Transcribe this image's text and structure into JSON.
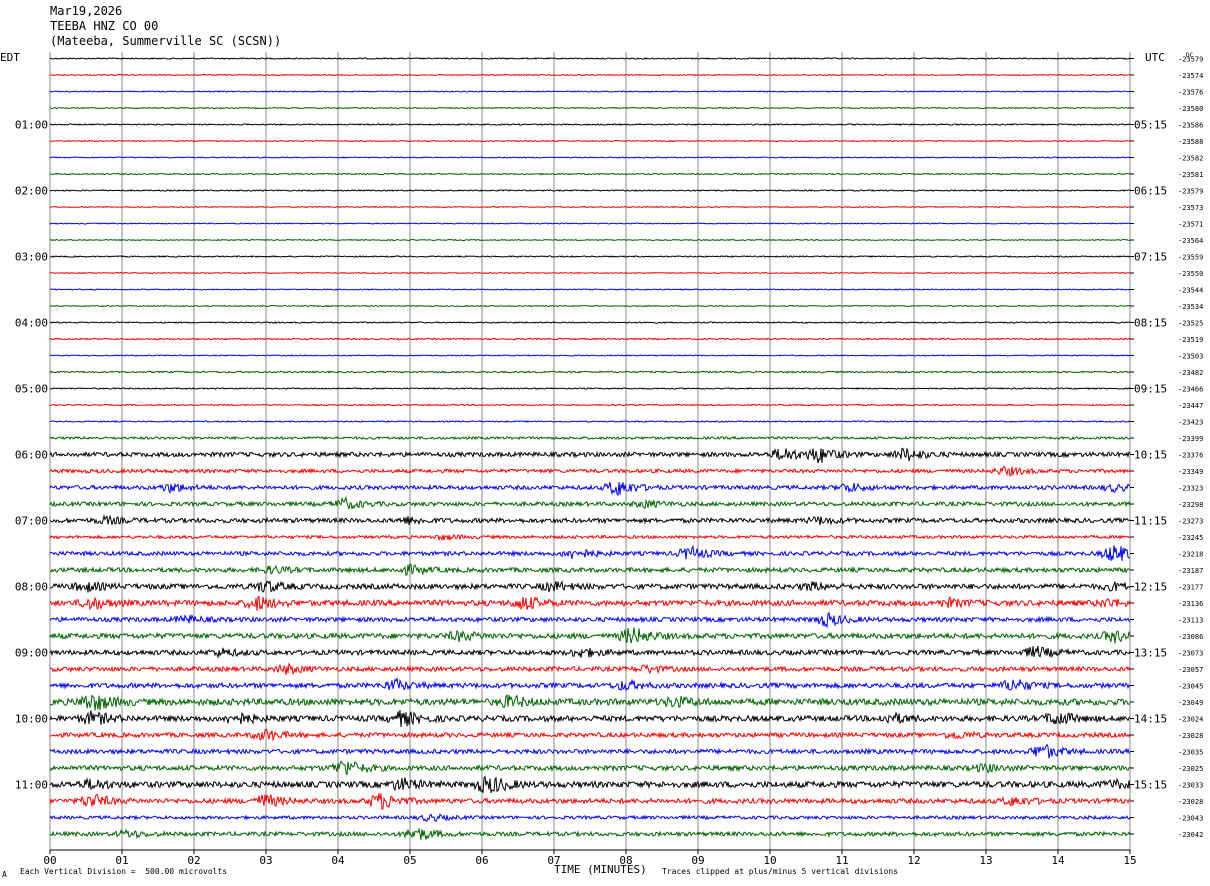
{
  "header": {
    "date": "Mar19,2026",
    "channel": "TEEBA HNZ CO 00",
    "location": "(Mateeba, Summerville SC (SCSN))"
  },
  "footer": {
    "scale_note": "Each Vertical Division =  500.00 microvolts",
    "clip_note": "Traces clipped at plus/minus 5 vertical divisions",
    "corner_mark": "A"
  },
  "chart_data": {
    "type": "line",
    "title": "TEEBA HNZ CO 00",
    "xlabel": "TIME (MINUTES)",
    "left_axis_label": "EDT",
    "right_axis_label": "UTC",
    "right_top_label": "DC",
    "x_ticks": [
      "00",
      "01",
      "02",
      "03",
      "04",
      "05",
      "06",
      "07",
      "08",
      "09",
      "10",
      "11",
      "12",
      "13",
      "14",
      "15"
    ],
    "xlim": [
      0,
      15
    ],
    "grid": true,
    "trace_colors": [
      "#000000",
      "#ff0000",
      "#0000ff",
      "#006400"
    ],
    "left_hour_labels": [
      "01:00",
      "02:00",
      "03:00",
      "04:00",
      "05:00",
      "06:00",
      "07:00",
      "08:00",
      "09:00",
      "10:00",
      "11:00"
    ],
    "right_hour_labels": [
      "05:15",
      "06:15",
      "07:15",
      "08:15",
      "09:15",
      "10:15",
      "11:15",
      "12:15",
      "13:15",
      "14:15",
      "15:15"
    ],
    "dc_offsets": [
      "-23579",
      "-23574",
      "-23576",
      "-23580",
      "-23586",
      "-23588",
      "-23582",
      "-23581",
      "-23579",
      "-23573",
      "-23571",
      "-23564",
      "-23559",
      "-23550",
      "-23544",
      "-23534",
      "-23525",
      "-23519",
      "-23503",
      "-23482",
      "-23466",
      "-23447",
      "-23423",
      "-23399",
      "-23376",
      "-23349",
      "-23323",
      "-23298",
      "-23273",
      "-23245",
      "-23218",
      "-23187",
      "-23177",
      "-23136",
      "-23113",
      "-23086",
      "-23073",
      "-23057",
      "-23045",
      "-23049",
      "-23024",
      "-23028",
      "-23035",
      "-23025",
      "-23033",
      "-23028",
      "-23043",
      "-23042"
    ],
    "noise_levels": [
      0.6,
      0.5,
      0.5,
      0.5,
      0.6,
      0.5,
      0.5,
      0.6,
      0.6,
      0.5,
      0.5,
      0.5,
      0.6,
      0.5,
      0.5,
      0.5,
      0.6,
      0.7,
      0.5,
      0.8,
      0.6,
      0.6,
      0.6,
      1.2,
      2.2,
      1.8,
      2.0,
      2.0,
      2.2,
      1.5,
      2.0,
      2.2,
      2.6,
      2.8,
      2.2,
      2.6,
      2.4,
      2.2,
      2.4,
      3.2,
      2.8,
      2.2,
      2.2,
      2.4,
      3.0,
      2.4,
      1.6,
      2.0
    ],
    "events": [
      [],
      [],
      [],
      [],
      [],
      [],
      [],
      [],
      [],
      [],
      [],
      [],
      [],
      [],
      [],
      [],
      [],
      [],
      [],
      [],
      [],
      [],
      [],
      [],
      [
        [
          10.2,
          6
        ],
        [
          10.7,
          7
        ],
        [
          11.9,
          6
        ]
      ],
      [
        [
          13.3,
          4
        ]
      ],
      [
        [
          1.7,
          4
        ],
        [
          7.9,
          8
        ],
        [
          11.1,
          4
        ],
        [
          14.8,
          3
        ]
      ],
      [
        [
          4.1,
          5
        ],
        [
          8.3,
          3
        ]
      ],
      [
        [
          0.8,
          3
        ],
        [
          5.0,
          3
        ],
        [
          10.7,
          3
        ]
      ],
      [
        [
          5.5,
          2
        ]
      ],
      [
        [
          7.3,
          5
        ],
        [
          8.9,
          6
        ],
        [
          14.8,
          9
        ]
      ],
      [
        [
          3.1,
          3
        ],
        [
          5.0,
          4
        ]
      ],
      [
        [
          0.5,
          4
        ],
        [
          3.0,
          5
        ],
        [
          7.0,
          4
        ],
        [
          10.6,
          3
        ],
        [
          14.8,
          3
        ]
      ],
      [
        [
          0.6,
          5
        ],
        [
          2.9,
          6
        ],
        [
          6.6,
          6
        ],
        [
          12.5,
          3
        ],
        [
          14.7,
          3
        ]
      ],
      [
        [
          1.9,
          3
        ],
        [
          10.8,
          6
        ]
      ],
      [
        [
          5.7,
          4
        ],
        [
          8.1,
          8
        ],
        [
          14.8,
          5
        ]
      ],
      [
        [
          2.4,
          3
        ],
        [
          7.4,
          4
        ],
        [
          13.7,
          5
        ]
      ],
      [
        [
          3.3,
          4
        ],
        [
          8.3,
          3
        ]
      ],
      [
        [
          4.8,
          5
        ],
        [
          8.0,
          4
        ],
        [
          13.4,
          6
        ]
      ],
      [
        [
          0.6,
          9
        ],
        [
          6.4,
          5
        ],
        [
          8.7,
          4
        ]
      ],
      [
        [
          0.6,
          6
        ],
        [
          2.6,
          5
        ],
        [
          4.9,
          7
        ],
        [
          11.7,
          4
        ],
        [
          14.0,
          6
        ]
      ],
      [
        [
          3.0,
          5
        ],
        [
          12.6,
          3
        ]
      ],
      [
        [
          13.8,
          7
        ]
      ],
      [
        [
          4.1,
          8
        ],
        [
          13.0,
          3
        ]
      ],
      [
        [
          0.6,
          4
        ],
        [
          4.9,
          5
        ],
        [
          6.1,
          9
        ],
        [
          14.8,
          3
        ]
      ],
      [
        [
          0.6,
          6
        ],
        [
          3.0,
          6
        ],
        [
          4.6,
          8
        ],
        [
          13.4,
          4
        ]
      ],
      [
        [
          5.3,
          3
        ]
      ],
      [
        [
          1.1,
          3
        ],
        [
          5.1,
          6
        ]
      ]
    ]
  }
}
